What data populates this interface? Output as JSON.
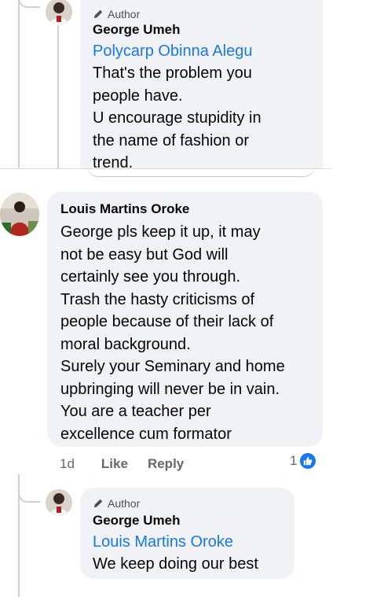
{
  "comments": [
    {
      "badge": "Author",
      "name": "George Umeh",
      "mention": "Polycarp Obinna Alegu",
      "lines": [
        "That's the problem you",
        "people have.",
        "U encourage stupidity in",
        "the name of fashion or",
        "trend."
      ]
    },
    {
      "name": "Louis Martins Oroke",
      "lines": [
        "George pls keep it up, it may",
        "not be easy but God will",
        "certainly see you through.",
        "Trash the hasty criticisms of",
        "people because of their lack of",
        "moral background.",
        "Surely your Seminary and home",
        "upbringing will never be in vain.",
        "You are a teacher per",
        "excellence cum formator"
      ],
      "time": "1d",
      "like_label": "Like",
      "reply_label": "Reply",
      "reaction_count": "1"
    },
    {
      "badge": "Author",
      "name": "George Umeh",
      "mention": "Louis Martins Oroke",
      "lines": [
        "We keep doing our best"
      ]
    }
  ],
  "colors": {
    "link": "#1877f2",
    "bubble": "#f0f2f5",
    "like_blue": "#1877f2"
  }
}
